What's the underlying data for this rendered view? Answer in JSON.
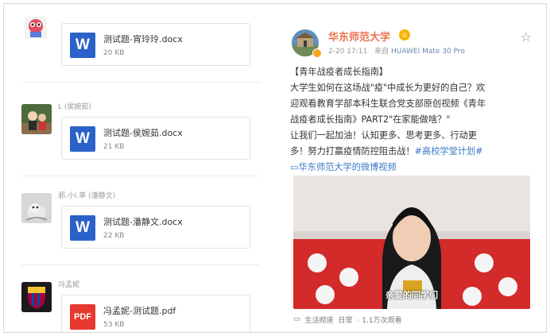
{
  "chat": {
    "messages": [
      {
        "sender": "",
        "file_name": "测试题-宵玲玲.docx",
        "file_size": "20 KB",
        "file_type": "W"
      },
      {
        "sender": "L (侯婉茹)",
        "file_name": "测试题-侯婉茹.docx",
        "file_size": "21 KB",
        "file_type": "W"
      },
      {
        "sender": "邪.小i.莘 (潘静文)",
        "file_name": "测试题-潘静文.docx",
        "file_size": "22 KB",
        "file_type": "W"
      },
      {
        "sender": "冯孟妮",
        "file_name": "冯孟妮-测试题.pdf",
        "file_size": "53 KB",
        "file_type": "PDF"
      }
    ]
  },
  "post": {
    "author": "华东师范大学",
    "time": "2-20 17:11",
    "source_prefix": "来自",
    "source": "HUAWEI Mate 30 Pro",
    "text_lines": [
      "【青年战疫者成长指南】",
      "大学生如何在这场战\"疫\"中成长为更好的自己？欢",
      "迎观看教育学部本科生联合党支部原创视频《青年",
      "战疫者成长指南》PART2\"在家能做啥？\"",
      "让我们一起加油！认知更多、思考更多、行动更"
    ],
    "text_last_plain": "多！努力打赢疫情防控阻击战！",
    "hashtag": "#高校学堂计划#",
    "video_link": "华东师范大学的微博视频",
    "video_subtitle": "亲爱的同学们",
    "video_category": "生活频道",
    "video_dot": "日常",
    "video_views": "· 1.1万次观看"
  },
  "colors": {
    "author": "#eb7350",
    "link": "#3a78c9",
    "word_icon": "#2b62c9",
    "pdf_icon": "#e5392f"
  }
}
